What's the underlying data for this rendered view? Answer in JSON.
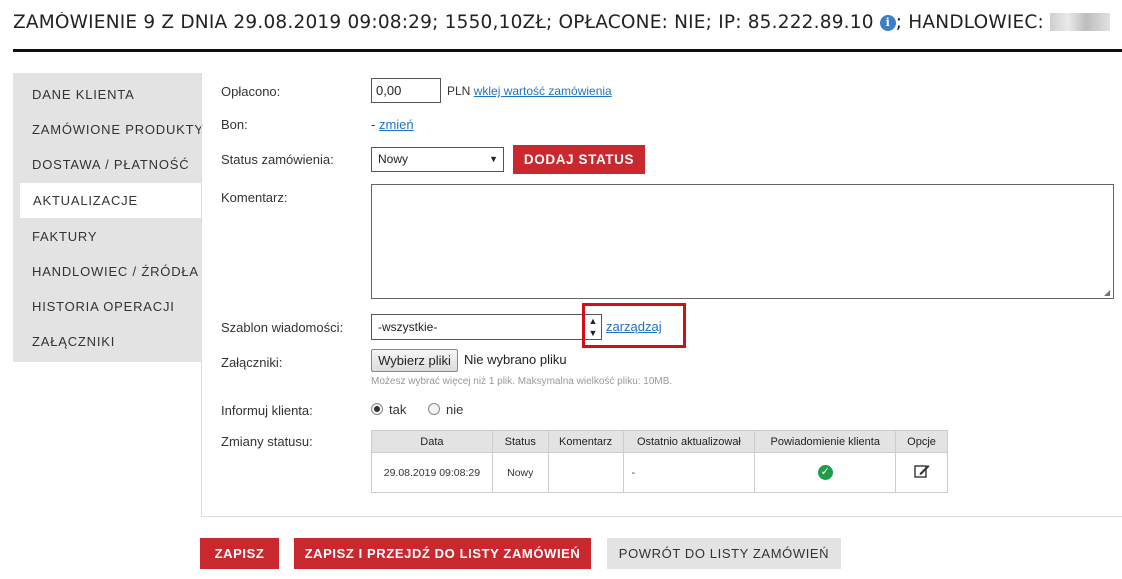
{
  "header": {
    "title_prefix": "ZAMÓWIENIE 9 Z DNIA 29.08.2019 09:08:29; 1550,10ZŁ; OPŁACONE: NIE; IP: 85.222.89.10",
    "title_suffix": "; HANDLOWIEC:",
    "info_icon": "info-icon"
  },
  "sidebar": {
    "items": [
      {
        "label": "DANE KLIENTA",
        "active": false
      },
      {
        "label": "ZAMÓWIONE PRODUKTY",
        "active": false
      },
      {
        "label": "DOSTAWA / PŁATNOŚĆ",
        "active": false
      },
      {
        "label": "AKTUALIZACJE",
        "active": true
      },
      {
        "label": "FAKTURY",
        "active": false
      },
      {
        "label": "HANDLOWIEC / ŹRÓDŁA",
        "active": false
      },
      {
        "label": "HISTORIA OPERACJI",
        "active": false
      },
      {
        "label": "ZAŁĄCZNIKI",
        "active": false
      }
    ]
  },
  "form": {
    "paid_label": "Opłacono:",
    "paid_value": "0,00",
    "currency": "PLN",
    "paste_link": "wklej wartość zamówienia",
    "bon_label": "Bon:",
    "bon_dash": "- ",
    "bon_change": "zmień",
    "status_label": "Status zamówienia:",
    "status_value": "Nowy",
    "add_status_button": "DODAJ STATUS",
    "comment_label": "Komentarz:",
    "comment_value": "",
    "template_label": "Szablon wiadomości:",
    "template_value": "-wszystkie-",
    "manage_link": "zarządzaj",
    "attachments_label": "Załączniki:",
    "choose_files_button": "Wybierz pliki",
    "no_file_text": "Nie wybrano pliku",
    "attachments_hint": "Możesz wybrać więcej niż 1 plik. Maksymalna wielkość pliku: 10MB.",
    "inform_label": "Informuj klienta:",
    "inform_yes": "tak",
    "inform_no": "nie",
    "inform_selected": "tak",
    "changes_label": "Zmiany statusu:"
  },
  "status_table": {
    "headers": [
      "Data",
      "Status",
      "Komentarz",
      "Ostatnio aktualizował",
      "Powiadomienie klienta",
      "Opcje"
    ],
    "rows": [
      {
        "date": "29.08.2019 09:08:29",
        "status": "Nowy",
        "comment": "",
        "updated_by": "-",
        "notified": "check-icon",
        "options": "edit-icon"
      }
    ]
  },
  "footer": {
    "save_button": "ZAPISZ",
    "save_list_button": "ZAPISZ I PRZEJDŹ DO LISTY ZAMÓWIEŃ",
    "back_button": "POWRÓT DO LISTY ZAMÓWIEŃ"
  },
  "colors": {
    "accent_red": "#c9292e",
    "link_blue": "#1f73c4",
    "highlight_red": "#d10f14",
    "success_green": "#1e9d4b"
  }
}
